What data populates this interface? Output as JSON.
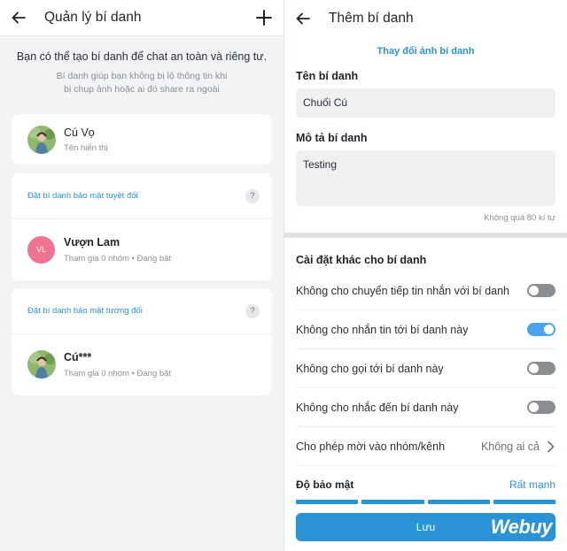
{
  "left": {
    "title": "Quản lý bí danh",
    "intro_main": "Bạn có thể tạo bí danh để chat an toàn và riêng tư.",
    "intro_sub_1": "Bí danh giúp bạn không bị lộ thông tin khi",
    "intro_sub_2": "bị chụp ảnh hoặc ai đó share ra ngoài",
    "profile": {
      "name": "Cú Vọ",
      "caption": "Tên hiển thị"
    },
    "sections": [
      {
        "title": "Đặt bí danh bảo mật tuyệt đối",
        "help": "?",
        "alias": {
          "initials": "VL",
          "name": "Vượn Lam",
          "meta": "Tham gia 0 nhóm • Đang bật"
        }
      },
      {
        "title": "Đặt bí danh bảo mật tương đối",
        "help": "?",
        "alias": {
          "name": "Cú***",
          "meta": "Tham gia 0 nhóm • Đang bật"
        }
      }
    ]
  },
  "right": {
    "title": "Thêm bí danh",
    "change_photo": "Thay đổi ảnh bí danh",
    "name_label": "Tên bí danh",
    "name_value": "Chuối Cú",
    "desc_label": "Mô tả bí danh",
    "desc_value": "Testing",
    "char_limit": "Không quá 80 kí tự",
    "settings_title": "Cài đặt khác cho bí danh",
    "settings": [
      {
        "label": "Không cho chuyển tiếp tin nhắn với bí danh",
        "on": false
      },
      {
        "label": "Không cho nhắn tin tới bí danh này",
        "on": true
      },
      {
        "label": "Không cho gọi tới bí danh này",
        "on": false
      },
      {
        "label": "Không cho nhắc đến bí danh này",
        "on": false
      }
    ],
    "invite_label": "Cho phép mời vào nhóm/kênh",
    "invite_value": "Không ai cả",
    "security_label": "Độ bảo mật",
    "security_value": "Rất mạnh",
    "security_level": 4,
    "save_label": "Lưu",
    "watermark": "Webuy"
  },
  "colors": {
    "accent": "#2a93d5",
    "toggle_on": "#4aa3f0",
    "toggle_off": "#8a8d91",
    "avatar_vl": "#ee7390"
  }
}
